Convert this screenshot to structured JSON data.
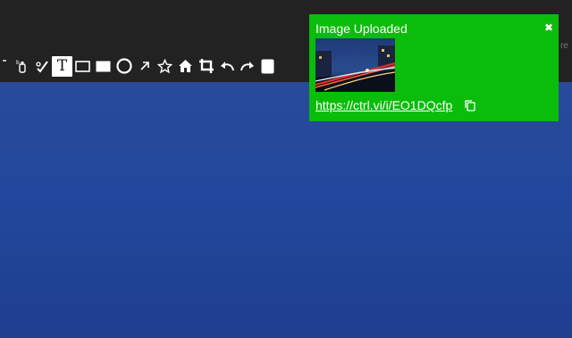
{
  "toast": {
    "title": "Image Uploaded",
    "close_icon": "close-icon",
    "link": "https://ctrl.vi/i/EO1DQcfp",
    "copy_icon": "copy-icon",
    "background": "#0bbd0b"
  },
  "toolbar": {
    "background": "#222222",
    "share_fragment": "re",
    "tools": [
      {
        "icon": "pen-icon"
      },
      {
        "icon": "marker-icon"
      },
      {
        "icon": "brush-icon"
      },
      {
        "icon": "text-icon",
        "glyph": "T",
        "active": true
      },
      {
        "icon": "rectangle-outline-icon"
      },
      {
        "icon": "rectangle-filled-icon"
      },
      {
        "icon": "circle-outline-icon"
      },
      {
        "icon": "arrow-icon"
      },
      {
        "icon": "star-icon"
      },
      {
        "icon": "home-icon"
      },
      {
        "icon": "crop-icon"
      },
      {
        "icon": "undo-icon"
      },
      {
        "icon": "redo-icon"
      },
      {
        "icon": "color-swatch-icon"
      }
    ]
  },
  "canvas": {
    "background": "#22479c"
  }
}
